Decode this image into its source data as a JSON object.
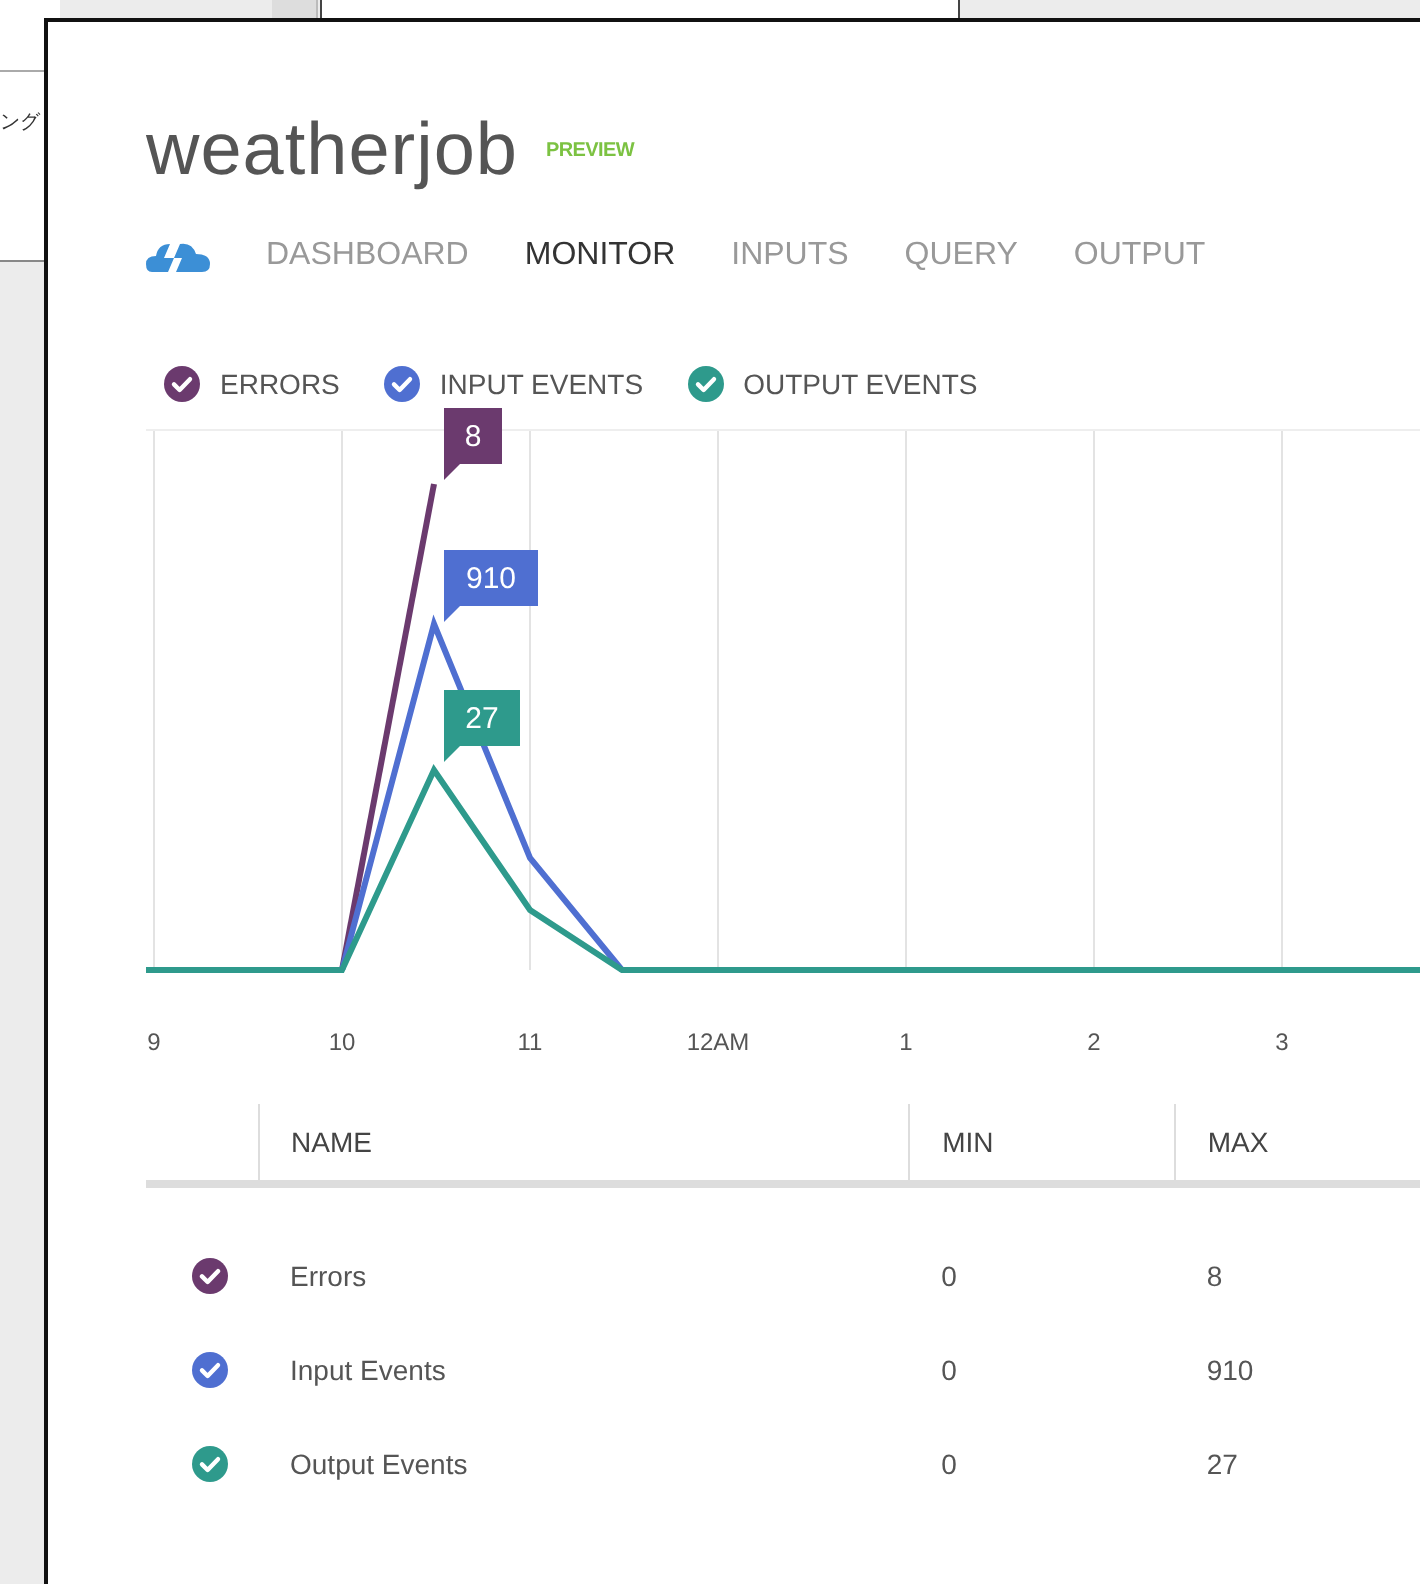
{
  "background_window": {
    "text_fragment": "ング"
  },
  "window": {
    "title": "weatherjob",
    "badge": "PREVIEW"
  },
  "tabs": [
    {
      "label": "DASHBOARD",
      "selected": false
    },
    {
      "label": "MONITOR",
      "selected": true
    },
    {
      "label": "INPUTS",
      "selected": false
    },
    {
      "label": "QUERY",
      "selected": false
    },
    {
      "label": "OUTPUT",
      "selected": false
    }
  ],
  "legend": [
    {
      "label": "ERRORS",
      "checked": true,
      "color": "#6b3a6e"
    },
    {
      "label": "INPUT EVENTS",
      "checked": true,
      "color": "#4f6fd1"
    },
    {
      "label": "OUTPUT EVENTS",
      "checked": true,
      "color": "#2e9a8c"
    }
  ],
  "chart": {
    "x_labels": [
      "9",
      "10",
      "11",
      "12AM",
      "1",
      "2",
      "3"
    ],
    "callouts": [
      "8",
      "910",
      "27"
    ]
  },
  "table": {
    "columns": [
      "NAME",
      "MIN",
      "MAX"
    ],
    "rows": [
      {
        "checked": true,
        "color": "#6b3a6e",
        "name": "Errors",
        "min": "0",
        "max": "8"
      },
      {
        "checked": true,
        "color": "#4f6fd1",
        "name": "Input Events",
        "min": "0",
        "max": "910"
      },
      {
        "checked": true,
        "color": "#2e9a8c",
        "name": "Output Events",
        "min": "0",
        "max": "27"
      }
    ]
  }
}
